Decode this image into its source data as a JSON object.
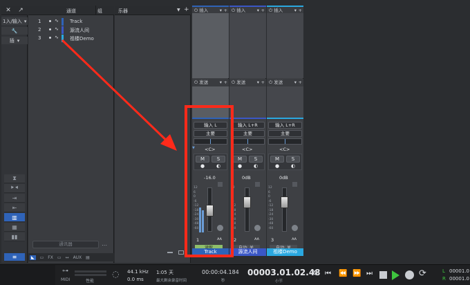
{
  "left_strip": {
    "close_glyph": "✕",
    "expand_glyph": "↗",
    "input_label": "1入/输入",
    "tool_label": "🔧",
    "insert_label": "插",
    "bottom_icons": [
      "▲▼",
      "◀▶",
      "▶|",
      "|▶",
      "keyboard",
      "grid",
      "bars"
    ]
  },
  "track_list": {
    "col_tracks": "通道",
    "col_group": "组",
    "tracks": [
      {
        "num": "1",
        "name": "Track",
        "color": "#2f63b8"
      },
      {
        "num": "2",
        "name": "源流人间",
        "color": "#3a57c6"
      },
      {
        "num": "3",
        "name": "祖楼Demo",
        "color": "#2aa8e0"
      }
    ],
    "filter_placeholder": "通讯器",
    "bottom_tabs": [
      "◣",
      "▭",
      "FX",
      "▭",
      "↔",
      "AUX",
      "▤"
    ]
  },
  "instruments": {
    "title": "乐器",
    "menu": "▼",
    "add": "+"
  },
  "channels": [
    {
      "insert": "插入",
      "send": "发送",
      "input": "输入 L",
      "output": "主要",
      "pan": "<C>",
      "mute": "M",
      "solo": "S",
      "gain": "-16.0",
      "num": "1",
      "auto": "读取",
      "name": "Track",
      "color": "#2f63b8"
    },
    {
      "insert": "插入",
      "send": "发送",
      "input": "输入 L+R",
      "output": "主要",
      "pan": "<C>",
      "mute": "M",
      "solo": "S",
      "gain": "0dB",
      "num": "2",
      "auto": "自动: 关",
      "name": "源流人间",
      "color": "#3a57c6"
    },
    {
      "insert": "插入",
      "send": "发送",
      "input": "输入 L+R",
      "output": "主要",
      "pan": "<C>",
      "mute": "M",
      "solo": "S",
      "gain": "0dB",
      "num": "3",
      "auto": "自动: 关",
      "name": "祖楼Demo",
      "color": "#2aa8e0"
    }
  ],
  "transport": {
    "midi": "MIDI",
    "perf": "性能",
    "sample_rate": "44.1 kHz",
    "latency": "0.0 ms",
    "days": "1:05 天",
    "max_record": "最大剩余录音时间",
    "time": "00:00:04.184",
    "time_unit": "秒",
    "bars": "00003.01.02.48",
    "bars_unit": "小节",
    "right_L": "L",
    "right_R": "R",
    "right_val1": "00001.0",
    "right_val2": "00001.0"
  }
}
